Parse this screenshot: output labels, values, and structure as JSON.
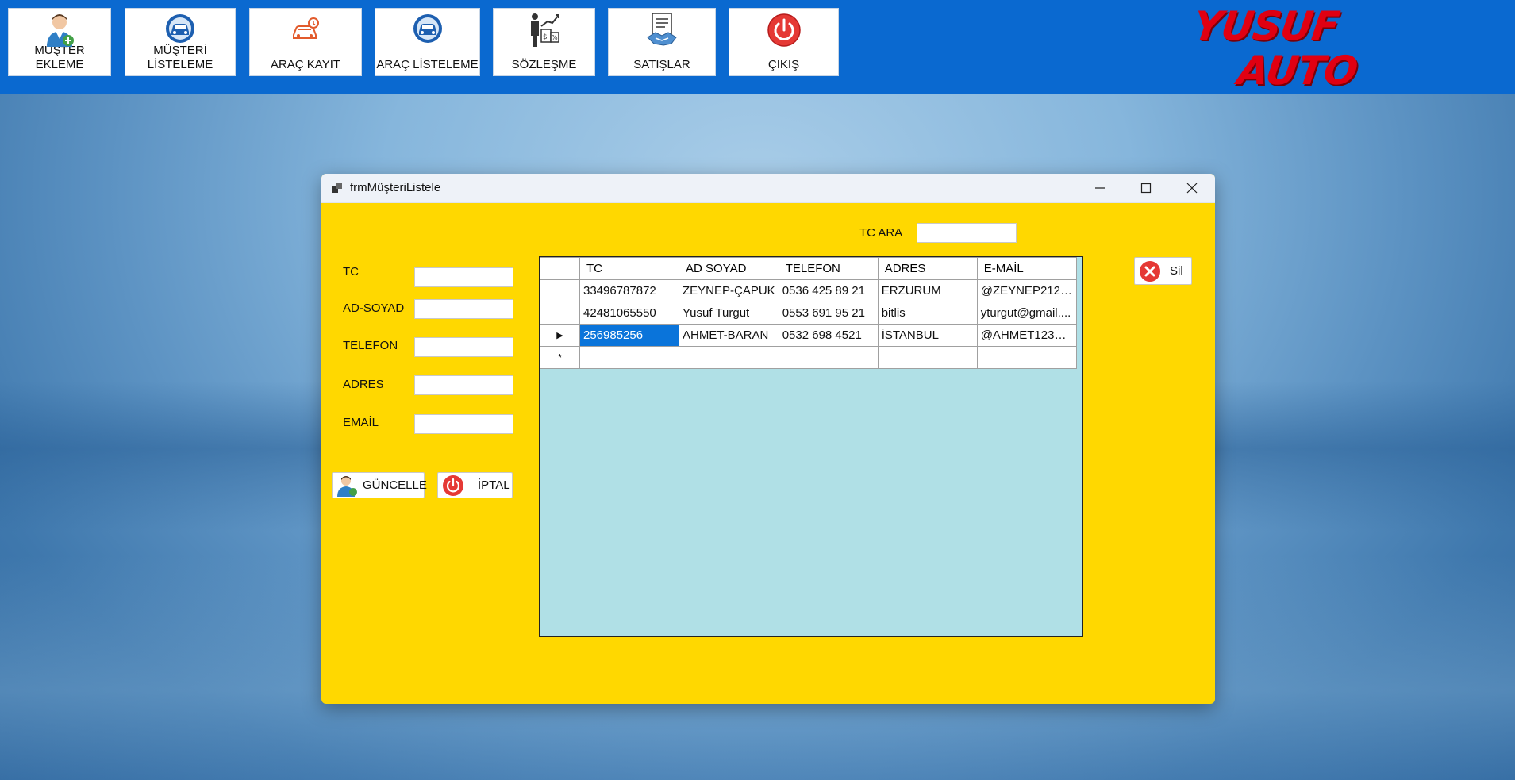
{
  "toolbar": {
    "buttons": [
      {
        "label": "MÜŞTER EKLEME",
        "icon": "person-add-icon"
      },
      {
        "label": "MÜŞTERİ\nLİSTELEME",
        "icon": "car-badge-icon"
      },
      {
        "label": "ARAÇ KAYIT",
        "icon": "car-outline-icon"
      },
      {
        "label": "ARAÇ LİSTELEME",
        "icon": "car-badge-icon"
      },
      {
        "label": "SÖZLEŞME",
        "icon": "contract-chart-icon"
      },
      {
        "label": "SATIŞLAR",
        "icon": "handshake-document-icon"
      },
      {
        "label": "ÇIKIŞ",
        "icon": "power-icon"
      }
    ]
  },
  "logo": {
    "line1": "YUSUF",
    "line2": "AUTO",
    "color": "#e00012"
  },
  "window": {
    "title": "frmMüşteriListele",
    "search": {
      "label": "TC ARA",
      "value": ""
    },
    "form": {
      "fields": [
        {
          "label": "TC",
          "value": ""
        },
        {
          "label": "AD-SOYAD",
          "value": ""
        },
        {
          "label": "TELEFON",
          "value": ""
        },
        {
          "label": "ADRES",
          "value": ""
        },
        {
          "label": "EMAİL",
          "value": ""
        }
      ],
      "update_label": "GÜNCELLE",
      "cancel_label": "İPTAL"
    },
    "delete_label": "Sil",
    "grid": {
      "columns": [
        "TC",
        "AD SOYAD",
        "TELEFON",
        "ADRES",
        "E-MAİL"
      ],
      "rows": [
        [
          "33496787872",
          "ZEYNEP-ÇAPUK",
          "0536 425 89 21",
          "ERZURUM",
          "@ZEYNEP2121..."
        ],
        [
          "42481065550",
          "Yusuf Turgut",
          "0553 691 95 21",
          "bitlis",
          "yturgut@gmail...."
        ],
        [
          "256985256",
          "AHMET-BARAN",
          "0532 698 4521",
          "İSTANBUL",
          "@AHMET123@..."
        ]
      ],
      "current_row_marker": "▶",
      "new_row_marker": "*"
    }
  },
  "colors": {
    "toolbar_bg": "#0a69d0",
    "form_bg": "#ffd800",
    "grid_bg": "#b0e0e6",
    "selection": "#0a74da"
  }
}
